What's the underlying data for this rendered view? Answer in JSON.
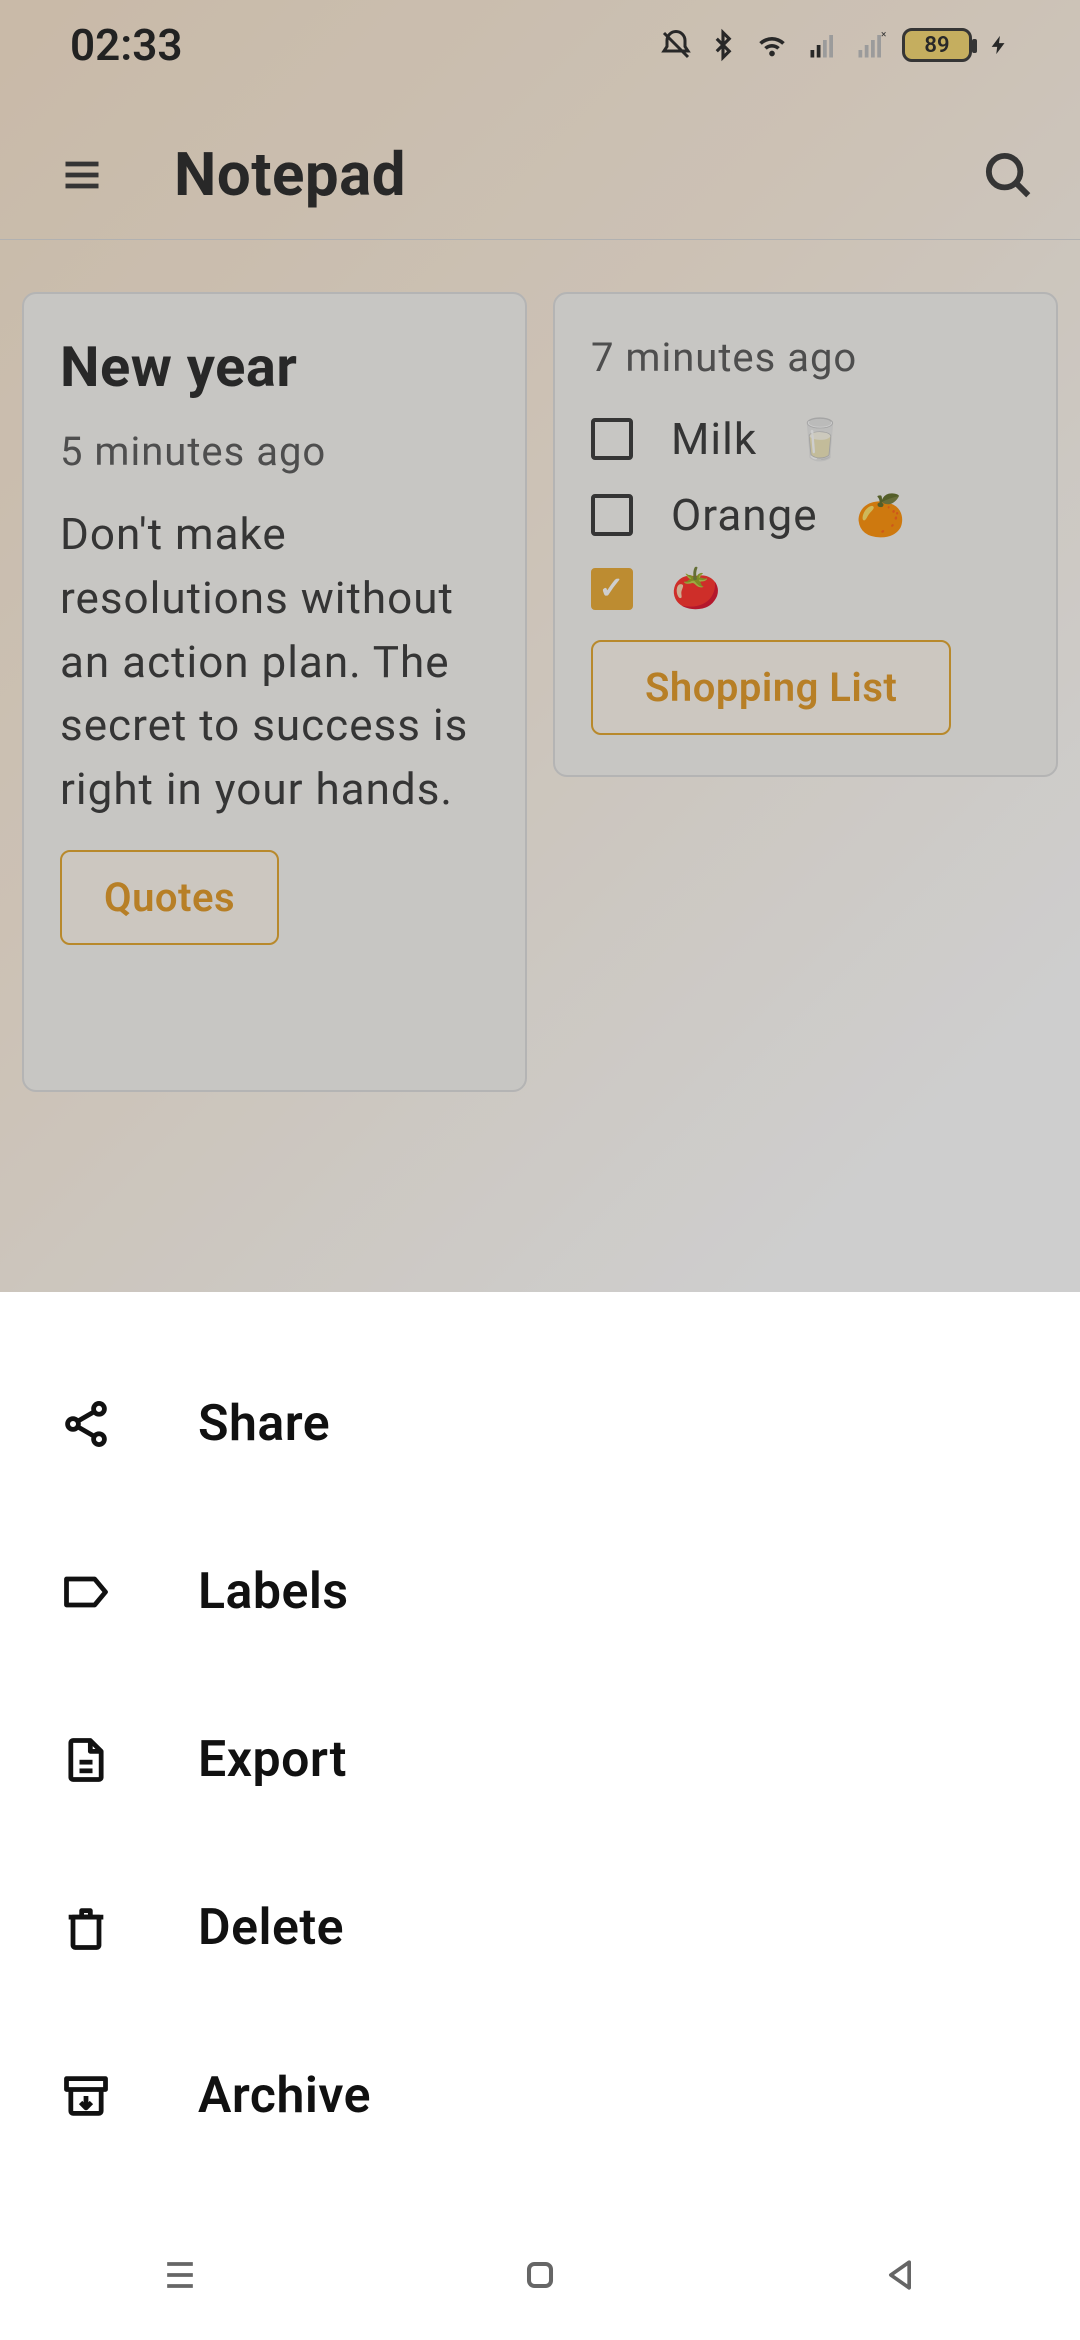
{
  "status": {
    "time": "02:33",
    "battery_percent": "89"
  },
  "app": {
    "title": "Notepad"
  },
  "notes": [
    {
      "title": "New year",
      "time": "5 minutes ago",
      "body": "Don't make resolutions without an action plan. The secret to success is right in your hands.",
      "tag": "Quotes"
    },
    {
      "time": "7 minutes ago",
      "checklist": [
        {
          "checked": false,
          "label": "Milk",
          "emoji": "🥛"
        },
        {
          "checked": false,
          "label": "Orange",
          "emoji": "🍊"
        },
        {
          "checked": true,
          "label": "",
          "emoji": "🍅"
        }
      ],
      "tag": "Shopping List"
    }
  ],
  "sheet": {
    "items": [
      {
        "label": "Share",
        "icon": "share"
      },
      {
        "label": "Labels",
        "icon": "label"
      },
      {
        "label": "Export",
        "icon": "export"
      },
      {
        "label": "Delete",
        "icon": "delete"
      },
      {
        "label": "Archive",
        "icon": "archive"
      }
    ]
  }
}
